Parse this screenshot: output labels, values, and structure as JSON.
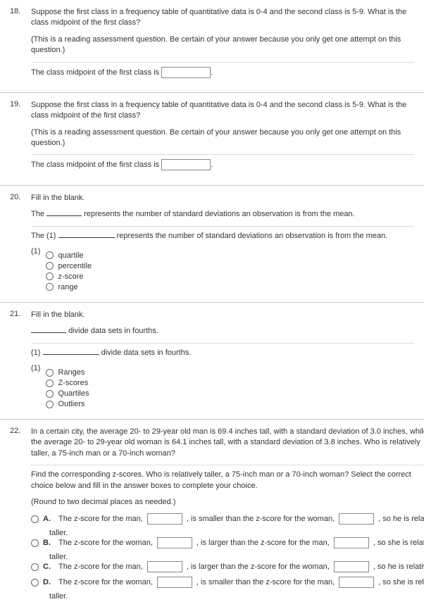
{
  "q18": {
    "num": "18.",
    "prompt": "Suppose the first class in a frequency table of quantitative data is 0-4 and the second class is 5-9. What is the class midpoint of the first class?",
    "note": "(This is a reading assessment question.  Be certain of your answer because you only get one attempt on this question.)",
    "answer_lead": "The class midpoint of the first class is"
  },
  "q19": {
    "num": "19.",
    "prompt": "Suppose the first class in a frequency table of quantitative data is 0-4 and the second class is 5-9. What is the class midpoint of the first class?",
    "note": "(This is a reading assessment question.  Be certain of your answer because you only get one attempt on this question.)",
    "answer_lead": "The class midpoint of the first class is"
  },
  "q20": {
    "num": "20.",
    "title": "Fill in the blank.",
    "sentence_lead": "The",
    "sentence_tail": "represents the number of standard deviations an observation is from the mean.",
    "restated_lead": "The (1)",
    "restated_tail": "represents the number of standard deviations an observation is from the mean.",
    "group_label": "(1)",
    "options": [
      "quartile",
      "percentile",
      "z-score",
      "range"
    ]
  },
  "q21": {
    "num": "21.",
    "title": "Fill in the blank.",
    "sentence_tail": "divide data sets in fourths.",
    "restated_lead": "(1)",
    "restated_tail": "divide data sets in fourths.",
    "group_label": "(1)",
    "options": [
      "Ranges",
      "Z-scores",
      "Quartiles",
      "Outliers"
    ]
  },
  "q22": {
    "num": "22.",
    "prompt": "In a certain city, the average 20- to 29-year old man is 69.4 inches tall, with a standard deviation of 3.0 inches, while the average 20- to 29-year old woman is 64.1 inches tall, with a standard deviation of 3.8 inches. Who is relatively taller, a 75-inch man or a 70-inch woman?",
    "instr": "Find the corresponding z-scores. Who is relatively taller, a 75-inch man or a 70-inch woman? Select the correct choice below and fill in the answer boxes to complete your choice.",
    "round": "(Round to two decimal places as needed.)",
    "choices": {
      "A": {
        "lead": "The z-score for the man,",
        "mid": ", is smaller than the z-score for the woman,",
        "tail": ", so he is relat",
        "tail2": "taller."
      },
      "B": {
        "lead": "The z-score for the woman,",
        "mid": ", is larger than the z-score for the man,",
        "tail": ", so she is relati",
        "tail2": "taller."
      },
      "C": {
        "lead": "The z-score for the man,",
        "mid": ", is larger than the z-score for the woman,",
        "tail": ", so he is relativ",
        "tail2": ""
      },
      "D": {
        "lead": "The z-score for the woman,",
        "mid": ", is smaller than the z-score for the man,",
        "tail": ", so she is rela",
        "tail2": "taller."
      }
    },
    "labels": {
      "A": "A.",
      "B": "B.",
      "C": "C.",
      "D": "D."
    }
  }
}
